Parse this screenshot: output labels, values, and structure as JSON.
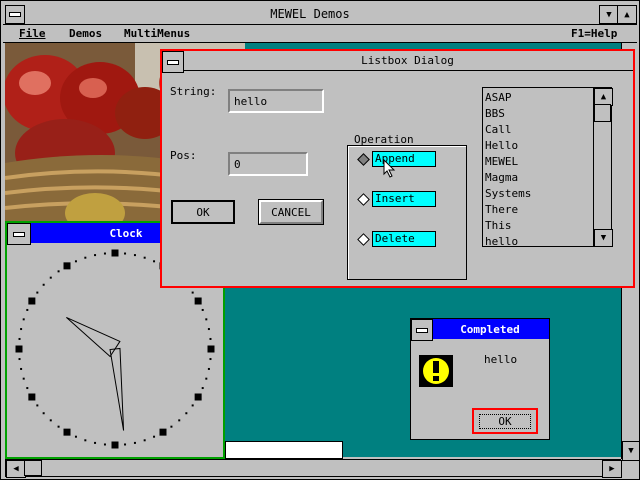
{
  "main_window": {
    "title": "MEWEL Demos",
    "menu": {
      "file": "File",
      "demos": "Demos",
      "multimenus": "MultiMenus",
      "help": "F1=Help"
    }
  },
  "listbox_dialog": {
    "title": "Listbox Dialog",
    "string_label": "String:",
    "string_value": "hello",
    "pos_label": "Pos:",
    "pos_value": "0",
    "ok_label": "OK",
    "cancel_label": "CANCEL",
    "operation_label": "Operation",
    "operations": [
      "Append",
      "Insert",
      "Delete"
    ],
    "selected_operation": "Append",
    "list_items": [
      "ASAP",
      "BBS",
      "Call",
      "Hello",
      "MEWEL",
      "Magma",
      "Systems",
      "There",
      "This",
      "hello"
    ]
  },
  "clock_window": {
    "title": "Clock",
    "hour_hand_hours": 10.1,
    "minute_hand_minutes": 29
  },
  "completed_dialog": {
    "title": "Completed",
    "message": "hello",
    "ok_label": "OK",
    "icon": "exclamation-icon"
  },
  "colors": {
    "title_active": "#0000ff",
    "desktop_teal": "#008080",
    "field_cyan": "#00ffff",
    "frame_red": "#ff0000"
  }
}
